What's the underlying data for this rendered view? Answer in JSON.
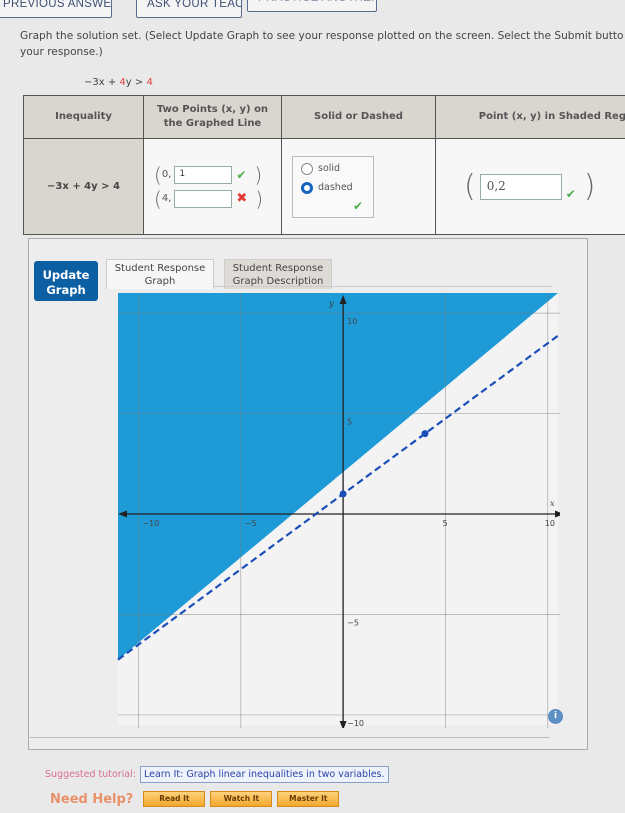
{
  "top_tabs": [
    "PREVIOUS ANSWERS",
    "ASK YOUR TEACHER",
    "PRACTICE ANOTHER"
  ],
  "instructions": "Graph the solution set. (Select Update Graph to see your response plotted on the screen. Select the Submit button for your response.)",
  "instructions_visible": "Graph the solution set. (Select Update Graph to see your response plotted on the screen. Select the Submit butto",
  "instructions_line2": "your response.)",
  "problem": {
    "lhs": "−3x + ",
    "coef": "4",
    "var": "y > ",
    "rhs": "4"
  },
  "table": {
    "headers": [
      "Inequality",
      "Two Points (x, y) on the Graphed Line",
      "Solid or Dashed",
      "Point (x, y) in Shaded Reg"
    ],
    "header_two_points_l1": "Two Points (x, y) on",
    "header_two_points_l2": "the Graphed Line",
    "inequality": "−3x + 4y > 4",
    "point1": {
      "x": "0,",
      "y_value": "1",
      "status": "correct"
    },
    "point2": {
      "x": "4,",
      "y_value": "",
      "status": "incorrect"
    },
    "line_style": {
      "options": [
        "solid",
        "dashed"
      ],
      "selected": "dashed",
      "status": "correct"
    },
    "shaded_point": {
      "value": "0,2",
      "status": "correct"
    }
  },
  "graph_panel": {
    "update_button": "Update Graph",
    "update_l1": "Update",
    "update_l2": "Graph",
    "tabs": [
      {
        "l1": "Student Response",
        "l2": "Graph",
        "active": true
      },
      {
        "l1": "Student Response",
        "l2": "Graph Description",
        "active": false
      }
    ]
  },
  "chart_data": {
    "type": "line",
    "title": "",
    "xlabel": "x",
    "ylabel": "y",
    "xlim": [
      -11,
      10.5
    ],
    "ylim": [
      -10.5,
      11
    ],
    "x_ticks": [
      -10,
      -5,
      5,
      10
    ],
    "y_ticks": [
      10,
      5,
      -5,
      -10
    ],
    "grid": true,
    "boundary": {
      "equation": "-3x + 4y = 4",
      "slope": 0.75,
      "intercept": 1,
      "style": "dashed"
    },
    "shaded_region": "above",
    "points": [
      {
        "x": 0,
        "y": 1
      },
      {
        "x": 4,
        "y": 4
      }
    ],
    "colors": {
      "shade": "#1e9bd7",
      "line": "#1a4fb8",
      "point": "#1a4fb8"
    }
  },
  "tutorial": {
    "label": "Suggested tutorial:",
    "link": "Learn It: Graph linear inequalities in two variables."
  },
  "help": {
    "label": "Need Help?",
    "buttons": [
      "Read It",
      "Watch It",
      "Master It"
    ]
  },
  "icons": {
    "correct": "✔",
    "incorrect": "✖",
    "info": "i"
  }
}
